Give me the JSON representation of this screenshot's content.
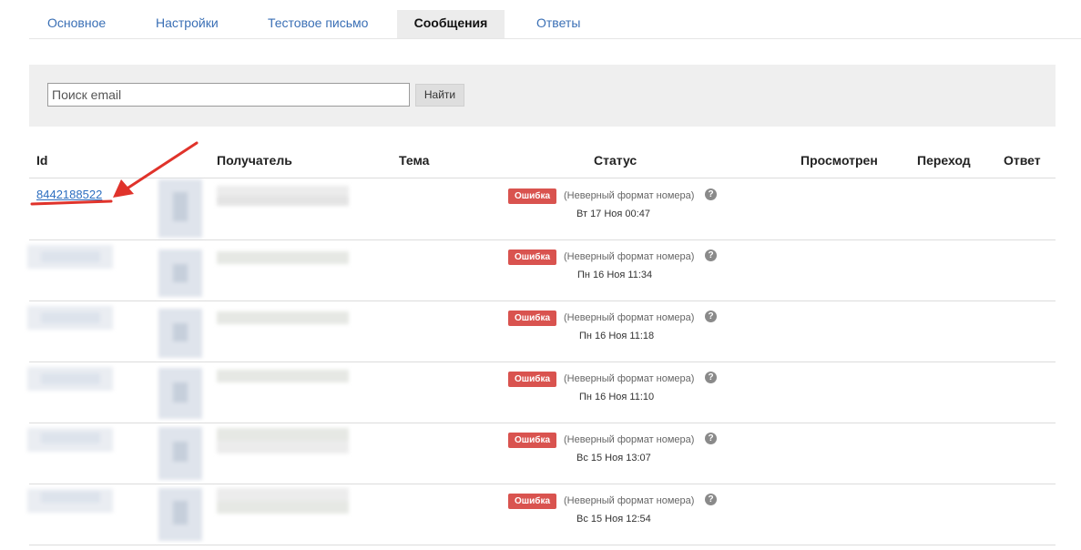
{
  "tabs": [
    {
      "label": "Основное",
      "active": false
    },
    {
      "label": "Настройки",
      "active": false
    },
    {
      "label": "Тестовое письмо",
      "active": false
    },
    {
      "label": "Сообщения",
      "active": true
    },
    {
      "label": "Ответы",
      "active": false
    }
  ],
  "search": {
    "placeholder": "Поиск email",
    "value": "",
    "button_label": "Найти"
  },
  "table": {
    "headers": {
      "id": "Id",
      "recipient": "Получатель",
      "subject": "Тема",
      "status": "Статус",
      "viewed": "Просмотрен",
      "clicked": "Переход",
      "reply": "Ответ"
    },
    "rows": [
      {
        "id": "8442188522",
        "status_badge": "Ошибка",
        "status_reason": "(Неверный формат номера)",
        "date": "Вт 17 Ноя 00:47"
      },
      {
        "id": "",
        "status_badge": "Ошибка",
        "status_reason": "(Неверный формат номера)",
        "date": "Пн 16 Ноя 11:34"
      },
      {
        "id": "",
        "status_badge": "Ошибка",
        "status_reason": "(Неверный формат номера)",
        "date": "Пн 16 Ноя 11:18"
      },
      {
        "id": "",
        "status_badge": "Ошибка",
        "status_reason": "(Неверный формат номера)",
        "date": "Пн 16 Ноя 11:10"
      },
      {
        "id": "",
        "status_badge": "Ошибка",
        "status_reason": "(Неверный формат номера)",
        "date": "Вс 15 Ноя 13:07"
      },
      {
        "id": "",
        "status_badge": "Ошибка",
        "status_reason": "(Неверный формат номера)",
        "date": "Вс 15 Ноя 12:54"
      }
    ]
  },
  "colors": {
    "error_badge": "#d9534f",
    "link": "#2d6ec0",
    "annotation": "#e0332b"
  },
  "icons": {
    "help": "question-circle-icon"
  }
}
